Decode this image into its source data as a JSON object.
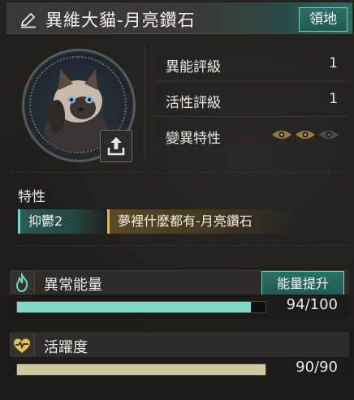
{
  "header": {
    "title": "異維大貓-月亮鑽石",
    "territory_button": "領地"
  },
  "stats": [
    {
      "label": "異能評級",
      "value": "1"
    },
    {
      "label": "活性評級",
      "value": "1"
    },
    {
      "label": "變異特性",
      "eyes_active": 2,
      "eyes_total": 3
    }
  ],
  "traits": {
    "title": "特性",
    "items": [
      {
        "label": "抑鬱2",
        "color": "#6fd6c4"
      },
      {
        "label": "夢裡什麼都有-月亮鑽石",
        "color": "#d6b46a"
      }
    ]
  },
  "energy": {
    "label": "異常能量",
    "boost_button": "能量提升",
    "value_text": "94/100",
    "current": 94,
    "max": 100,
    "color": "#7fd8c4"
  },
  "activity": {
    "label": "活躍度",
    "value_text": "90/90",
    "current": 90,
    "max": 90,
    "color": "#cfc9a2"
  },
  "icons": {
    "edit": "pencil-icon",
    "upload": "upload-icon",
    "energy": "flame-icon",
    "activity": "heartbeat-icon",
    "trait_eye": "eye-icon"
  }
}
